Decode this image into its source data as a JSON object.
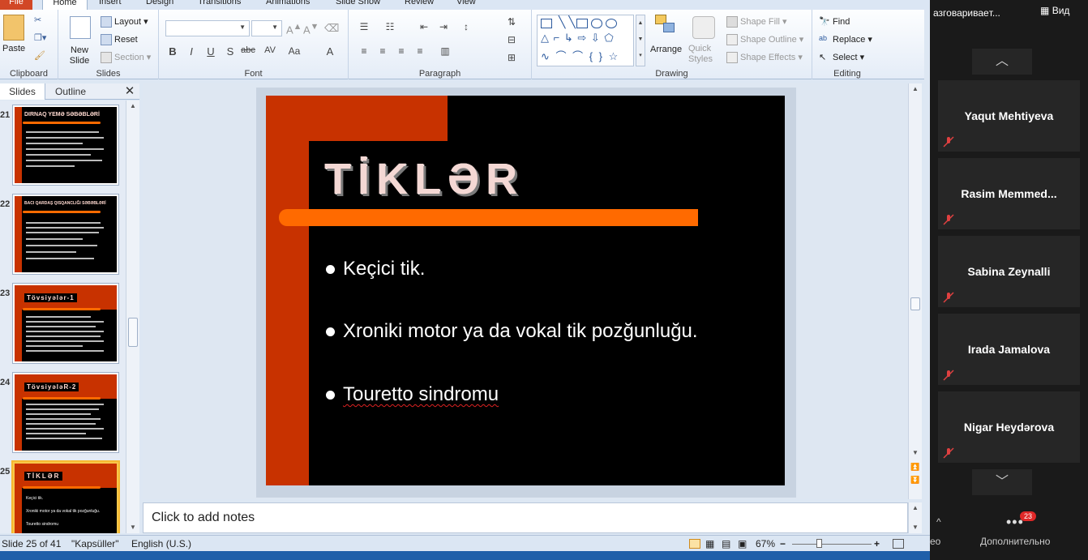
{
  "ribbon": {
    "tabs": [
      "File",
      "Home",
      "Insert",
      "Design",
      "Transitions",
      "Animations",
      "Slide Show",
      "Review",
      "View"
    ],
    "groups": {
      "clipboard": {
        "label": "Clipboard",
        "paste": "Paste"
      },
      "slides": {
        "label": "Slides",
        "new_slide": "New Slide",
        "layout": "Layout",
        "reset": "Reset",
        "section": "Section"
      },
      "font": {
        "label": "Font"
      },
      "paragraph": {
        "label": "Paragraph"
      },
      "drawing": {
        "label": "Drawing",
        "arrange": "Arrange",
        "quick_styles": "Quick Styles",
        "shape_fill": "Shape Fill",
        "shape_outline": "Shape Outline",
        "shape_effects": "Shape Effects"
      },
      "editing": {
        "label": "Editing",
        "find": "Find",
        "replace": "Replace",
        "select": "Select"
      }
    }
  },
  "panel": {
    "tabs": [
      "Slides",
      "Outline"
    ]
  },
  "thumbnails": [
    {
      "num": "21",
      "title": "DIRNAQ YEMƏ SƏBƏBLƏRİ"
    },
    {
      "num": "22",
      "title": "BACI QARDAŞ QISQANCLIĞI SƏBƏBLƏRİ"
    },
    {
      "num": "23",
      "title": "Tövsiyələr-1"
    },
    {
      "num": "24",
      "title": "TövsiyələR-2"
    },
    {
      "num": "25",
      "title": "TİKLƏR",
      "bullets": [
        "Keçici tik.",
        "Xroniki motor ya da vokal tik pozğunluğu.",
        "Touretto sindromu"
      ]
    }
  ],
  "slide": {
    "title": "TİKLƏR",
    "bullets": [
      "Keçici tik.",
      "Xroniki motor ya da vokal tik pozğunluğu.",
      "Touretto sindromu"
    ]
  },
  "notes": {
    "placeholder": "Click to add notes"
  },
  "status": {
    "slide": "Slide 25 of 41",
    "theme": "\"Kapsüller\"",
    "language": "English (U.S.)",
    "zoom": "67%"
  },
  "zoom_app": {
    "speaking": "азговариваeт...",
    "view": "Вид",
    "participants": [
      "Yaqut Mehtiyeva",
      "Rasim  Memmed...",
      "Sabina Zeynalli",
      "Irada Jamalova",
      "Nigar Heydərova"
    ],
    "more": "Дополнительно",
    "more_badge": "23",
    "video_label": "eo"
  }
}
